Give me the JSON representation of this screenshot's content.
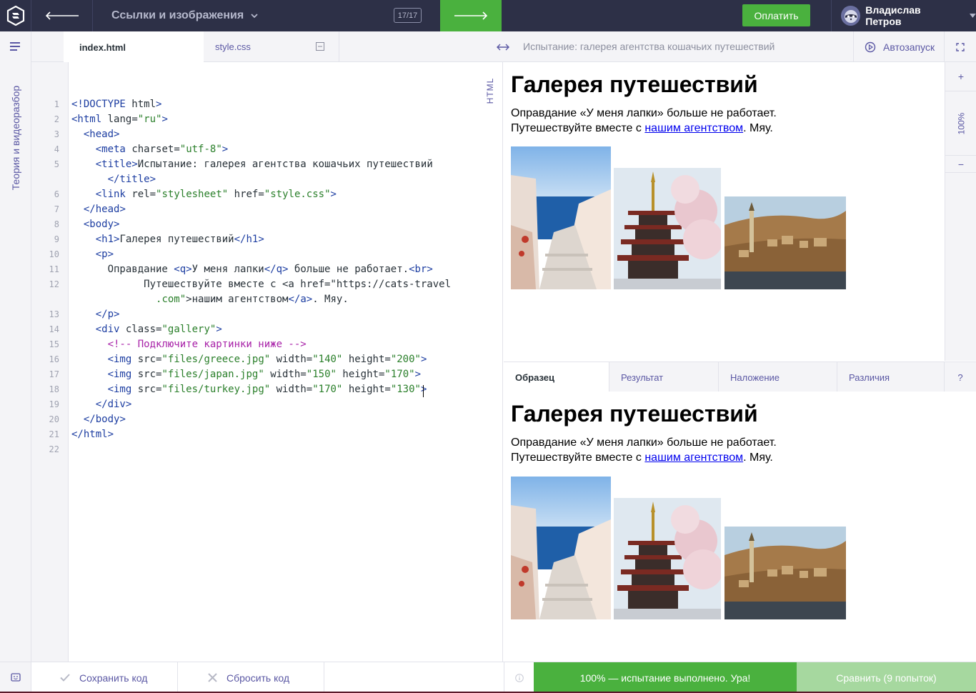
{
  "header": {
    "chapter_title": "Ссылки и изображения",
    "progress": "17/17",
    "pay_label": "Оплатить",
    "user_name": "Владислав Петров"
  },
  "sidebar": {
    "theory_label": "Теория и видеоразбор"
  },
  "editor": {
    "tabs": [
      {
        "label": "index.html",
        "active": true
      },
      {
        "label": "style.css",
        "active": false
      }
    ],
    "language_label": "HTML",
    "line_numbers": [
      "1",
      "2",
      "3",
      "4",
      "5",
      "6",
      "7",
      "8",
      "9",
      "10",
      "11",
      "12",
      "13",
      "14",
      "15",
      "16",
      "17",
      "18",
      "19",
      "20",
      "21",
      "22"
    ],
    "code_lines": [
      "<!DOCTYPE html>",
      "<html lang=\"ru\">",
      "  <head>",
      "    <meta charset=\"utf-8\">",
      "    <title>Испытание: галерея агентства кошачьих путешествий",
      "      </title>",
      "    <link rel=\"stylesheet\" href=\"style.css\">",
      "  </head>",
      "  <body>",
      "    <h1>Галерея путешествий</h1>",
      "    <p>",
      "      Оправдание <q>У меня лапки</q> больше не работает.<br>",
      "            Путешествуйте вместе с <a href=\"https://cats-travel",
      "              .com\">нашим агентством</a>. Мяу.",
      "    </p>",
      "    <div class=\"gallery\">",
      "      <!-- Подключите картинки ниже -->",
      "      <img src=\"files/greece.jpg\" width=\"140\" height=\"200\">",
      "      <img src=\"files/japan.jpg\" width=\"150\" height=\"170\">",
      "      <img src=\"files/turkey.jpg\" width=\"170\" height=\"130\">",
      "    </div>",
      "  </body>",
      "</html>"
    ]
  },
  "preview": {
    "title": "Испытание: галерея агентства кошачьих путешествий",
    "autorun_label": "Автозапуск",
    "zoom_in": "+",
    "zoom_level": "100%",
    "zoom_out": "−",
    "page": {
      "heading": "Галерея путешествий",
      "line1": "Оправдание «У меня лапки» больше не работает.",
      "line2_before": "Путешествуйте вместе с ",
      "link_text": "нашим агентством",
      "line2_after": ". Мяу."
    }
  },
  "compare": {
    "tabs": [
      "Образец",
      "Результат",
      "Наложение",
      "Различия"
    ],
    "help": "?"
  },
  "footer": {
    "save_label": "Сохранить код",
    "reset_label": "Сбросить код",
    "status_text": "100% — испытание выполнено. Ура!",
    "compare_label": "Сравнить (9 попыток)"
  },
  "colors": {
    "header_bg": "#2d3047",
    "accent_green": "#4ab13e",
    "accent_purple": "#5b58a4",
    "link_blue": "#0000ee"
  }
}
